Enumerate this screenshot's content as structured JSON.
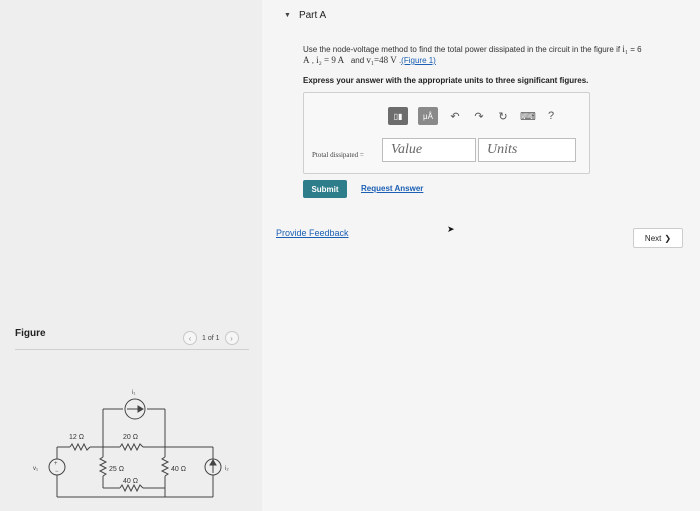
{
  "part": {
    "title": "Part A"
  },
  "problem": {
    "line1_prefix": "Use the node-voltage method to find the total power dissipated in the circuit in the figure if",
    "i1_symbol": "i₁",
    "i1_value": "= 6",
    "line2_a": "A",
    "i2_symbol": "i₂",
    "i2_value": "= 9 A",
    "and_text": "and",
    "v1_symbol": "v₁",
    "v1_value": "=48 V",
    "figure_link": "(Figure 1)"
  },
  "instruction": "Express your answer with the appropriate units to three significant figures.",
  "toolbar": {
    "template_label": "▯▮",
    "units_label": "μÅ",
    "undo_icon": "↶",
    "redo_icon": "↷",
    "reset_icon": "↻",
    "keyboard_icon": "⌨",
    "help_icon": "?"
  },
  "answer": {
    "label": "Ptotal dissipated =",
    "value_placeholder": "Value",
    "units_placeholder": "Units"
  },
  "submit_label": "Submit",
  "request_answer_label": "Request Answer",
  "feedback_label": "Provide Feedback",
  "next_label": "Next",
  "next_icon": "❯",
  "figure": {
    "title": "Figure",
    "prev_icon": "‹",
    "next_icon": "›",
    "page_indicator": "1 of 1"
  },
  "circuit": {
    "r1": "12 Ω",
    "r2": "20 Ω",
    "r3": "25 Ω",
    "r4": "40 Ω",
    "r5": "40 Ω",
    "i1": "i₁",
    "i2": "i₂",
    "v1": "v₁"
  }
}
